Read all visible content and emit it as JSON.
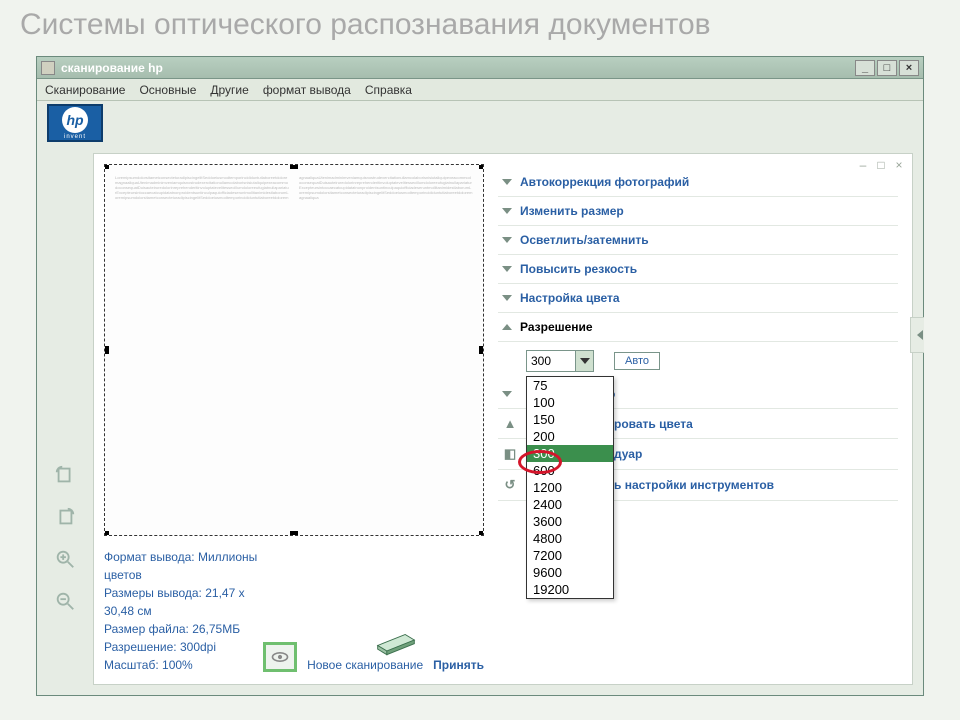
{
  "slide_title": "Системы оптического распознавания документов",
  "window": {
    "title": "сканирование hp",
    "controls": {
      "min": "_",
      "max": "□",
      "close": "×"
    }
  },
  "menu": {
    "scan": "Сканирование",
    "basic": "Основные",
    "other": "Другие",
    "output": "формат вывода",
    "help": "Справка"
  },
  "hp_logo": {
    "mark": "hp",
    "sub": "invent"
  },
  "panel_controls": {
    "min": "–",
    "max": "□",
    "close": "×"
  },
  "info": {
    "format_label": "Формат вывода:",
    "format_value": "Миллионы цветов",
    "dims_label": "Размеры вывода:",
    "dims_value": "21,47 x 30,48 см",
    "filesize_label": "Размер файла:",
    "filesize_value": "26,75МБ",
    "res_label": "Разрешение:",
    "res_value": "300dpi",
    "scale_label": "Масштаб:",
    "scale_value": "100%"
  },
  "actions": {
    "new_scan": "Новое сканирование",
    "accept": "Принять"
  },
  "sections": {
    "autocorrect": "Автокоррекция фотографий",
    "resize": "Изменить размер",
    "lighten": "Осветлить/затемнить",
    "sharpen": "Повысить резкость",
    "color": "Настройка цвета",
    "resolution": "Разрешение"
  },
  "resolution": {
    "current": "300",
    "auto": "Авто",
    "options": [
      "75",
      "100",
      "150",
      "200",
      "300",
      "600",
      "1200",
      "2400",
      "3600",
      "4800",
      "7200",
      "9600",
      "19200"
    ],
    "selected_index": 4
  },
  "lower": {
    "row1_suffix": "о",
    "row2_suffix": "ровать цвета",
    "row3_suffix": "дуар",
    "row4_suffix": "ь настройки инструментов"
  },
  "tool_icons": {
    "rotate1": "⟲",
    "rotate2": "⟳",
    "zoom_in": "🔍+",
    "zoom_out": "🔍−"
  }
}
